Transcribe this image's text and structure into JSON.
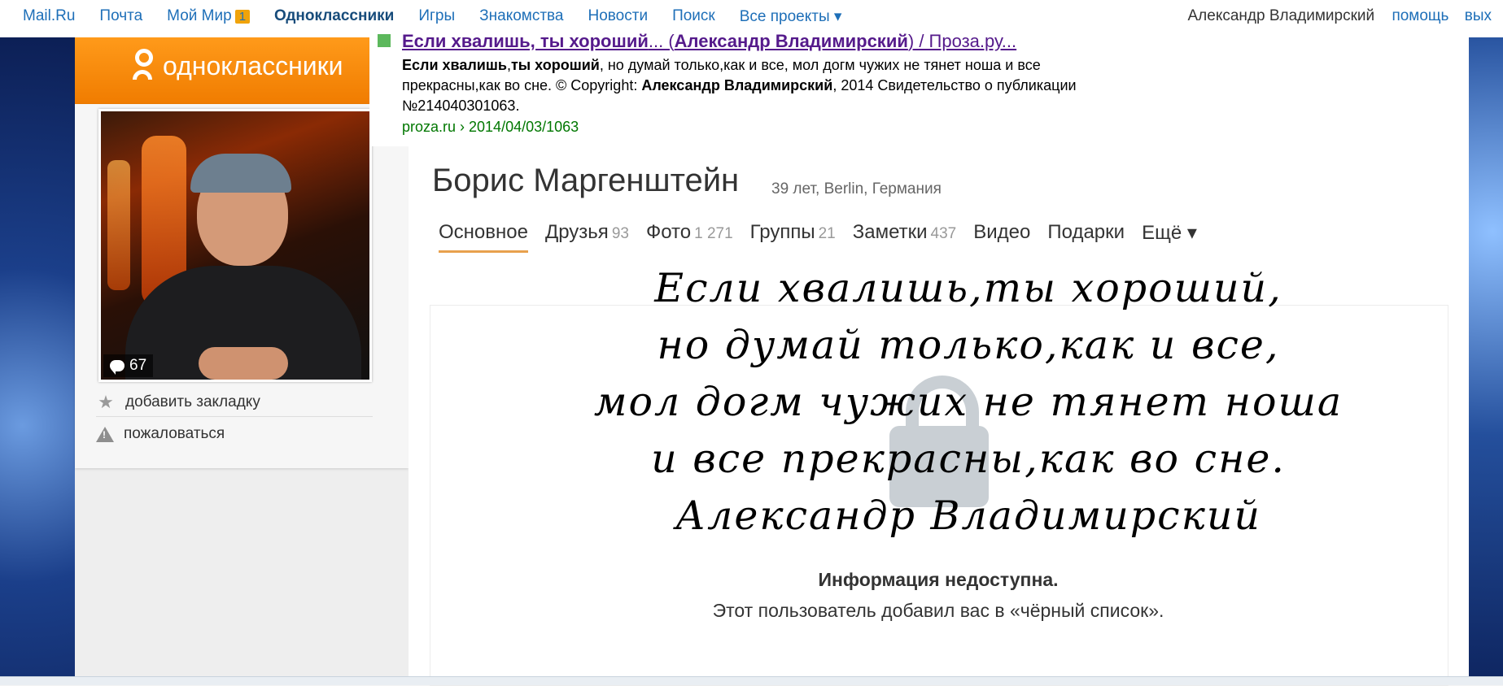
{
  "topbar": {
    "nav": [
      {
        "label": "Mail.Ru"
      },
      {
        "label": "Почта"
      },
      {
        "label": "Мой Мир",
        "badge": "1"
      },
      {
        "label": "Одноклассники",
        "active": true
      },
      {
        "label": "Игры"
      },
      {
        "label": "Знакомства"
      },
      {
        "label": "Новости"
      },
      {
        "label": "Поиск"
      },
      {
        "label": "Все проекты ▾"
      }
    ],
    "user_name": "Александр Владимирский",
    "help": "помощь",
    "exit": "вых"
  },
  "brand": {
    "logo_text": "одноклассники",
    "accent": "#f07c00"
  },
  "search_result": {
    "title_prefix": "Если хвалишь, ты хороший",
    "title_mid": "... (",
    "title_author": "Александр Владимирский",
    "title_suffix": ") / Проза.ру...",
    "snippet_bold1": "Если хвалишь",
    "snippet_bold2": "ты хороший",
    "snippet_sep": ",",
    "snippet_rest1": ", но думай только,как и все, мол догм чужих не тянет ноша и все прекрасны,как во сне. © Copyright: ",
    "snippet_author": "Александр Владимирский",
    "snippet_rest2": ", 2014 Свидетельство о публикации №214040301063.",
    "url": "proza.ru › 2014/04/03/1063"
  },
  "profile": {
    "name": "Борис Маргенштейн",
    "meta": "39 лет, Berlin, Германия",
    "comments_count": "67",
    "add_bookmark": "добавить закладку",
    "complain": "пожаловаться"
  },
  "tabs": [
    {
      "label": "Основное",
      "count": ""
    },
    {
      "label": "Друзья",
      "count": "93"
    },
    {
      "label": "Фото",
      "count": "1 271"
    },
    {
      "label": "Группы",
      "count": "21"
    },
    {
      "label": "Заметки",
      "count": "437"
    },
    {
      "label": "Видео",
      "count": ""
    },
    {
      "label": "Подарки",
      "count": ""
    },
    {
      "label": "Ещё ▾",
      "count": ""
    }
  ],
  "poem": {
    "lines": [
      "Если хвалишь,ты хороший,",
      "но думай только,как и все,",
      "мол догм чужих не тянет ноша",
      "и все прекрасны,как во сне.",
      "Александр Владимирский"
    ]
  },
  "blocked": {
    "title": "Информация недоступна.",
    "text": "Этот пользователь добавил вас в «чёрный список»."
  }
}
